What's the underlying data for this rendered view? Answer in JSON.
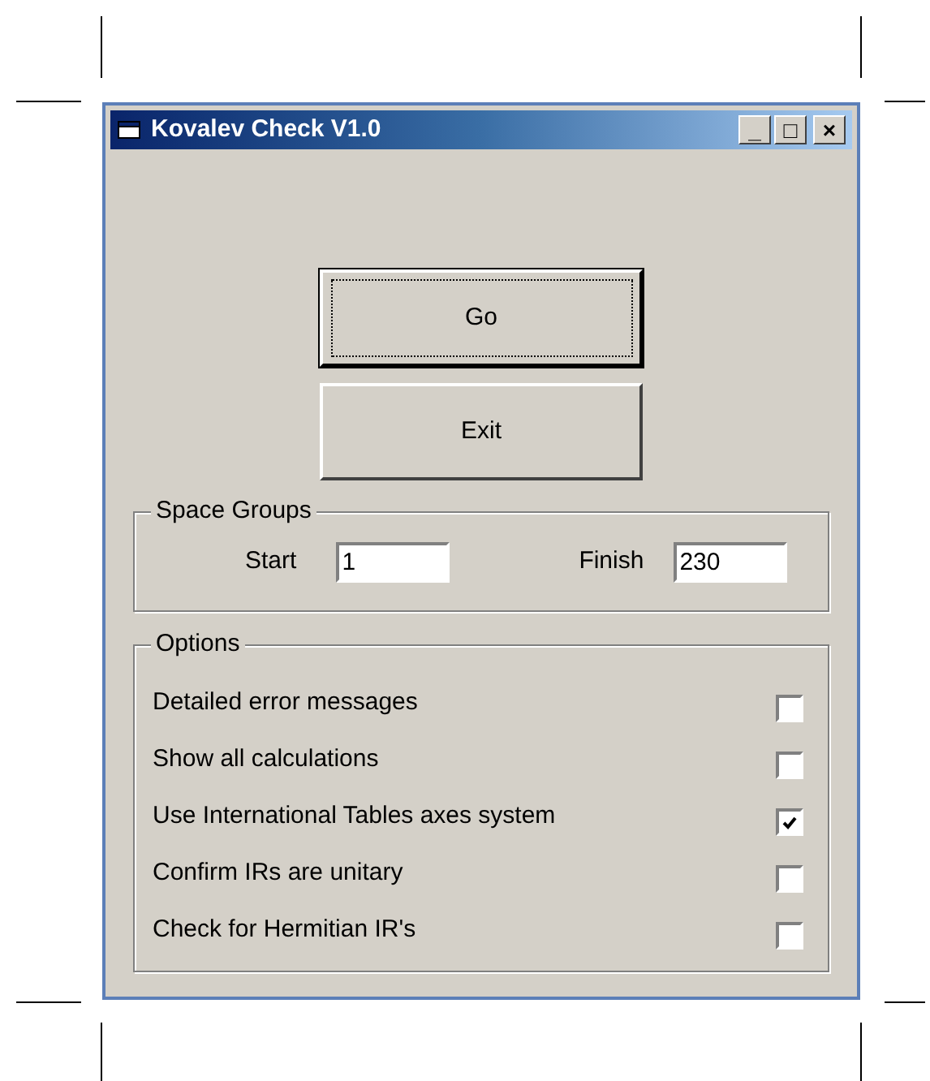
{
  "window": {
    "title": "Kovalev Check V1.0",
    "controls": [
      "_",
      "□",
      "×"
    ]
  },
  "buttons": [
    {
      "label": "Go",
      "focused": true
    },
    {
      "label": "Exit",
      "focused": false
    }
  ],
  "space_groups": {
    "title": "Space Groups",
    "start_label": "Start",
    "start_value": "1",
    "finish_label": "Finish",
    "finish_value": "230"
  },
  "options": {
    "title": "Options",
    "items": [
      {
        "label": "Detailed error messages",
        "checked": false
      },
      {
        "label": "Show all calculations",
        "checked": false
      },
      {
        "label": "Use International Tables axes system",
        "checked": true
      },
      {
        "label": "Confirm IRs are unitary",
        "checked": false
      },
      {
        "label": "Check for Hermitian IR's",
        "checked": false
      }
    ]
  }
}
